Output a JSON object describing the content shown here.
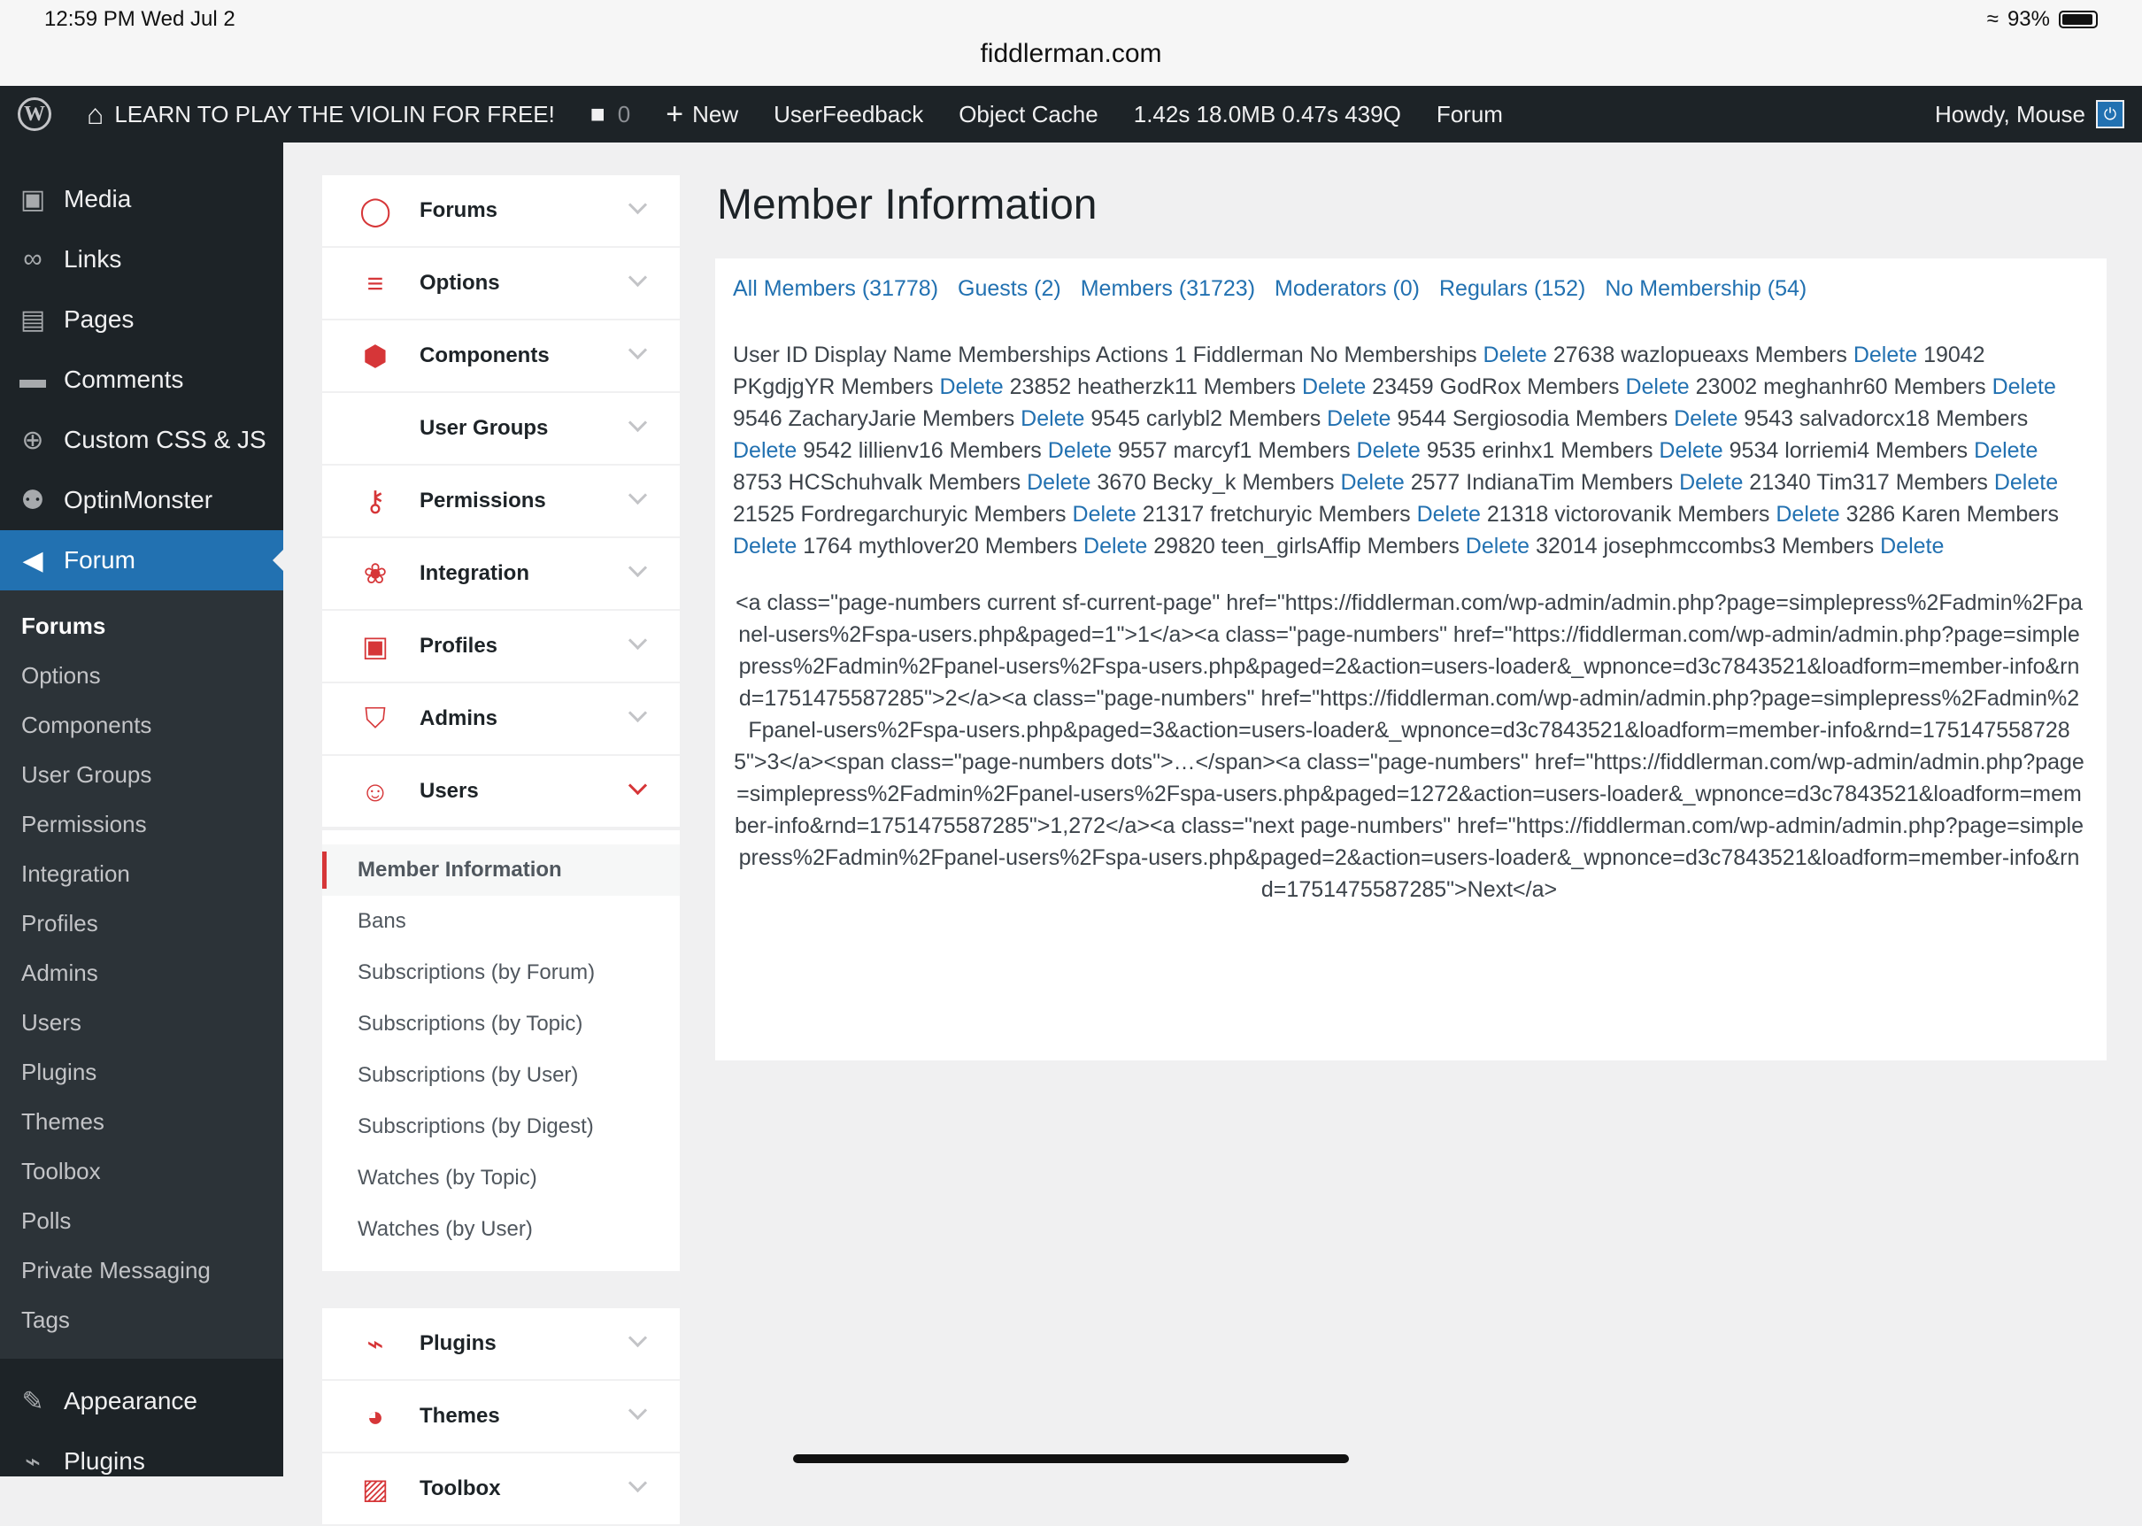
{
  "status_bar": {
    "time": "12:59 PM   Wed Jul 2",
    "battery": "93%",
    "url": "fiddlerman.com"
  },
  "admin_bar": {
    "wp_logo": "W",
    "site_name": "LEARN TO PLAY THE VIOLIN FOR FREE!",
    "comments_count": "0",
    "new_label": "New",
    "userfeedback": "UserFeedback",
    "object_cache": "Object Cache",
    "query_monitor": "1.42s  18.0MB  0.47s  439Q",
    "forum": "Forum",
    "howdy": "Howdy, Mouse"
  },
  "wp_menu": {
    "items_top": [
      {
        "label": "Media",
        "icon": "media-icon"
      },
      {
        "label": "Links",
        "icon": "links-icon"
      },
      {
        "label": "Pages",
        "icon": "pages-icon"
      },
      {
        "label": "Comments",
        "icon": "comments-icon"
      },
      {
        "label": "Custom CSS & JS",
        "icon": "plus-circle-icon"
      },
      {
        "label": "OptinMonster",
        "icon": "optinmonster-icon"
      },
      {
        "label": "Forum",
        "icon": "megaphone-icon"
      }
    ],
    "submenu": [
      "Forums",
      "Options",
      "Components",
      "User Groups",
      "Permissions",
      "Integration",
      "Profiles",
      "Admins",
      "Users",
      "Plugins",
      "Themes",
      "Toolbox",
      "Polls",
      "Private Messaging",
      "Tags"
    ],
    "items_bottom": [
      {
        "label": "Appearance",
        "icon": "brush-icon"
      },
      {
        "label": "Plugins",
        "icon": "plug-icon"
      }
    ]
  },
  "plugin_nav": {
    "groups_before": [
      "Forums",
      "Options",
      "Components",
      "User Groups",
      "Permissions",
      "Integration",
      "Profiles",
      "Admins",
      "Users"
    ],
    "users_subs": [
      "Member Information",
      "Bans",
      "Subscriptions (by Forum)",
      "Subscriptions (by Topic)",
      "Subscriptions (by User)",
      "Subscriptions (by Digest)",
      "Watches (by Topic)",
      "Watches (by User)"
    ],
    "groups_after": [
      "Plugins",
      "Themes",
      "Toolbox"
    ]
  },
  "main": {
    "title": "Member Information",
    "filters": [
      "All Members (31778)",
      "Guests (2)",
      "Members (31723)",
      "Moderators (0)",
      "Regulars (152)",
      "No Membership (54)"
    ],
    "header_text": "User ID Display Name Memberships Actions",
    "delete_label": "Delete",
    "members": [
      "1 Fiddlerman No Memberships",
      "27638 wazlopueaxs Members",
      "19042 PKgdjgYR Members",
      "23852 heatherzk11 Members",
      "23459 GodRox Members",
      "23002 meghanhr60 Members",
      "9546 ZacharyJarie Members",
      "9545 carlybl2 Members",
      "9544 Sergiosodia Members",
      "9543 salvadorcx18 Members",
      "9542 lillienv16 Members",
      "9557 marcyf1 Members",
      "9535 erinhx1 Members",
      "9534 lorriemi4 Members",
      "8753 HCSchuhvalk Members",
      "3670 Becky_k Members",
      "2577 IndianaTim Members",
      "21340 Tim317 Members",
      "21525 Fordregarchuryic Members",
      "21317 fretchuryic Members",
      "21318 victorovanik Members",
      "3286 Karen Members",
      "1764 mythlover20 Members",
      "29820 teen_girlsAffip Members",
      "32014 josephmccombs3 Members"
    ],
    "pagination_raw": "<a class=\"page-numbers current sf-current-page\" href=\"https://fiddlerman.com/wp-admin/admin.php?page=simplepress%2Fadmin%2Fpanel-users%2Fspa-users.php&paged=1\">1</a><a class=\"page-numbers\" href=\"https://fiddlerman.com/wp-admin/admin.php?page=simplepress%2Fadmin%2Fpanel-users%2Fspa-users.php&paged=2&action=users-loader&_wpnonce=d3c7843521&loadform=member-info&rnd=1751475587285\">2</a><a class=\"page-numbers\" href=\"https://fiddlerman.com/wp-admin/admin.php?page=simplepress%2Fadmin%2Fpanel-users%2Fspa-users.php&paged=3&action=users-loader&_wpnonce=d3c7843521&loadform=member-info&rnd=1751475587285\">3</a><span class=\"page-numbers dots\">…</span><a class=\"page-numbers\" href=\"https://fiddlerman.com/wp-admin/admin.php?page=simplepress%2Fadmin%2Fpanel-users%2Fspa-users.php&paged=1272&action=users-loader&_wpnonce=d3c7843521&loadform=member-info&rnd=1751475587285\">1,272</a><a class=\"next page-numbers\" href=\"https://fiddlerman.com/wp-admin/admin.php?page=simplepress%2Fadmin%2Fpanel-users%2Fspa-users.php&paged=2&action=users-loader&_wpnonce=d3c7843521&loadform=member-info&rnd=1751475587285\">Next</a>"
  },
  "colors": {
    "accent": "#2271b1",
    "brand_red": "#d63638",
    "admin_bg": "#1d2327"
  }
}
